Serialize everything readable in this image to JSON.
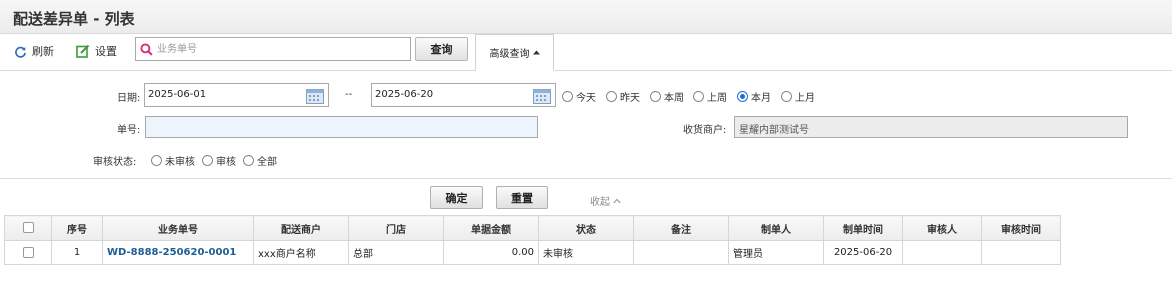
{
  "page": {
    "title": "配送差异单 - 列表"
  },
  "toolbar": {
    "refresh_label": "刷新",
    "settings_label": "设置",
    "search_placeholder": "业务单号",
    "search_value": "",
    "query_label": "查询",
    "advanced_label": "高级查询"
  },
  "filters": {
    "date_label": "日期:",
    "date_start": "2025-06-01",
    "date_sep": "--",
    "date_end": "2025-06-20",
    "quick_ranges": [
      {
        "label": "今天",
        "checked": false
      },
      {
        "label": "昨天",
        "checked": false
      },
      {
        "label": "本周",
        "checked": false
      },
      {
        "label": "上周",
        "checked": false
      },
      {
        "label": "本月",
        "checked": true
      },
      {
        "label": "上月",
        "checked": false
      }
    ],
    "order_no_label": "单号:",
    "order_no_value": "",
    "merchant_label": "收货商户:",
    "merchant_value": "星耀内部测试号",
    "audit_label": "审核状态:",
    "audit_options": [
      {
        "label": "未审核",
        "checked": false
      },
      {
        "label": "审核",
        "checked": false
      },
      {
        "label": "全部",
        "checked": false
      }
    ]
  },
  "actions": {
    "confirm_label": "确定",
    "reset_label": "重置",
    "collapse_label": "收起"
  },
  "table": {
    "columns": [
      "序号",
      "业务单号",
      "配送商户",
      "门店",
      "单据金额",
      "状态",
      "备注",
      "制单人",
      "制单时间",
      "审核人",
      "审核时间"
    ],
    "rows": [
      {
        "index": "1",
        "order_no": "WD-8888-250620-0001",
        "supplier": "xxx商户名称",
        "store": "总部",
        "amount": "0.00",
        "status": "未审核",
        "remark": "",
        "creator": "管理员",
        "created": "2025-06-20",
        "auditor": "",
        "audited": ""
      }
    ]
  },
  "colors": {
    "accent": "#1e6fd9",
    "link": "#1f5d95",
    "search_icon": "#e0287e",
    "settings_icon": "#3c9a3c",
    "refresh_icon": "#2a6fbf"
  }
}
